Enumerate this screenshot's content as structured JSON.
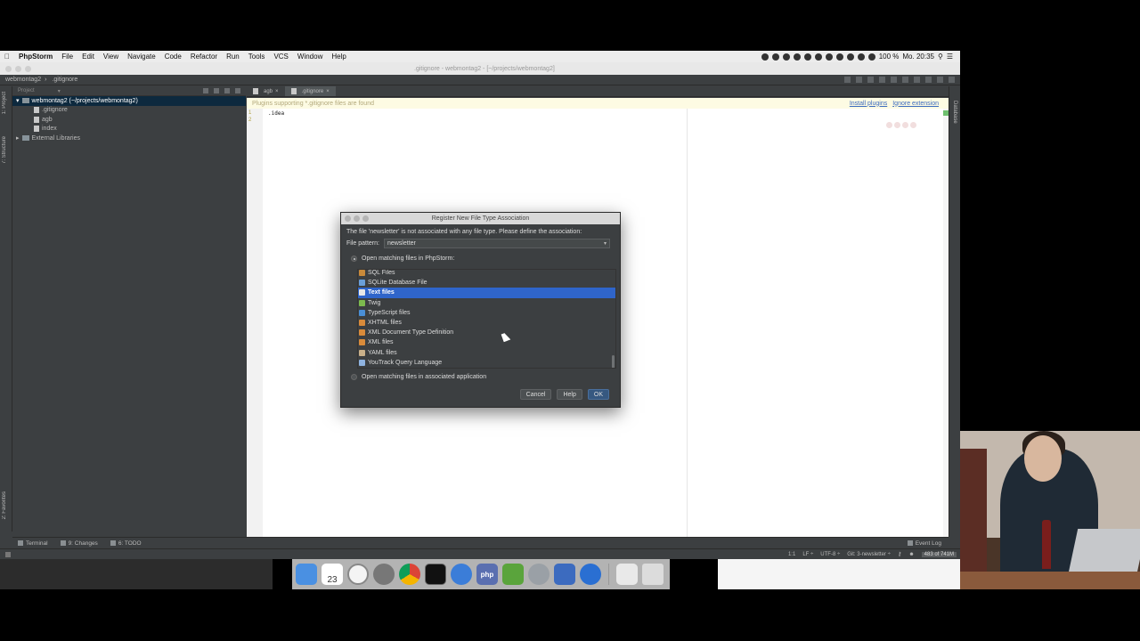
{
  "menubar": {
    "apple_icon": "apple-icon",
    "app_name": "PhpStorm",
    "items": [
      "File",
      "Edit",
      "View",
      "Navigate",
      "Code",
      "Refactor",
      "Run",
      "Tools",
      "VCS",
      "Window",
      "Help"
    ],
    "battery": "100 %",
    "clock": "Mo. 20:35"
  },
  "ide": {
    "window_title": ".gitignore - webmontag2 - [~/projects/webmontag2]",
    "breadcrumbs": [
      "webmontag2",
      ".gitignore"
    ],
    "left_stripe": {
      "project_tab": "1: Project",
      "structure_tab": "7: Structure",
      "favorites_tab": "2: Favorites"
    },
    "right_stripe": {
      "database_tab": "Database"
    },
    "project_panel": {
      "header": "Project",
      "tree": [
        {
          "label": "webmontag2 (~/projects/webmontag2)",
          "kind": "folder",
          "selected": true,
          "indent": 0
        },
        {
          "label": ".gitignore",
          "kind": "file",
          "indent": 1
        },
        {
          "label": "agb",
          "kind": "file",
          "indent": 1
        },
        {
          "label": "index",
          "kind": "file",
          "indent": 1
        },
        {
          "label": "External Libraries",
          "kind": "library",
          "indent": 0
        }
      ]
    },
    "editor_tabs": [
      {
        "label": "agb",
        "active": false
      },
      {
        "label": ".gitignore",
        "active": true
      }
    ],
    "banner": {
      "text": "Plugins supporting *.gitignore files are found",
      "install_link": "Install plugins",
      "ignore_link": "Ignore extension"
    },
    "line_numbers": [
      "1",
      "2"
    ],
    "code_lines": [
      ".idea",
      ""
    ],
    "bottom_tools": {
      "terminal": "Terminal",
      "changes": "9: Changes",
      "todo": "6: TODO",
      "event_log": "Event Log"
    },
    "status": {
      "position": "1:1",
      "line_sep": "LF ÷",
      "encoding": "UTF-8 ÷",
      "vcs": "Git: 3-newsletter ÷",
      "memory": "483 of 741M"
    }
  },
  "dialog": {
    "title": "Register New File Type Association",
    "message": "The file 'newsletter' is not associated with any file type. Please define the association:",
    "pattern_label": "File pattern:",
    "pattern_value": "newsletter",
    "option_phpstorm": "Open matching files in PhpStorm:",
    "option_app": "Open matching files in associated application",
    "file_types": [
      {
        "label": "SQL Files",
        "color": "#c98a3a",
        "selected": false
      },
      {
        "label": "SQLite Database File",
        "color": "#6a9fd8",
        "selected": false
      },
      {
        "label": "Text files",
        "color": "#e8e8e8",
        "selected": true
      },
      {
        "label": "Twig",
        "color": "#7dbb4e",
        "selected": false
      },
      {
        "label": "TypeScript files",
        "color": "#4a8fd6",
        "selected": false
      },
      {
        "label": "XHTML files",
        "color": "#d98b3a",
        "selected": false
      },
      {
        "label": "XML Document Type Definition",
        "color": "#d98b3a",
        "selected": false
      },
      {
        "label": "XML files",
        "color": "#d98b3a",
        "selected": false
      },
      {
        "label": "YAML files",
        "color": "#c9b08a",
        "selected": false
      },
      {
        "label": "YouTrack Query Language",
        "color": "#8fb3e0",
        "selected": false
      }
    ],
    "buttons": {
      "cancel": "Cancel",
      "help": "Help",
      "ok": "OK"
    }
  },
  "dock": {
    "calendar_day": "23",
    "php_label": "php",
    "apps": [
      "finder-icon",
      "calendar-icon",
      "clock-icon",
      "system-preferences-icon",
      "chrome-icon",
      "terminal-icon",
      "mamp-icon",
      "phpstorm-icon",
      "robot-icon",
      "power-icon",
      "cup-icon",
      "quicktime-icon",
      "preview-icon",
      "trash-icon"
    ]
  },
  "colors": {
    "ide_bg": "#3c3f41",
    "selection_blue": "#2f65ca",
    "tree_selection": "#0d293e",
    "banner_bg": "#fdfbe3",
    "link_blue": "#3c6bbf"
  }
}
